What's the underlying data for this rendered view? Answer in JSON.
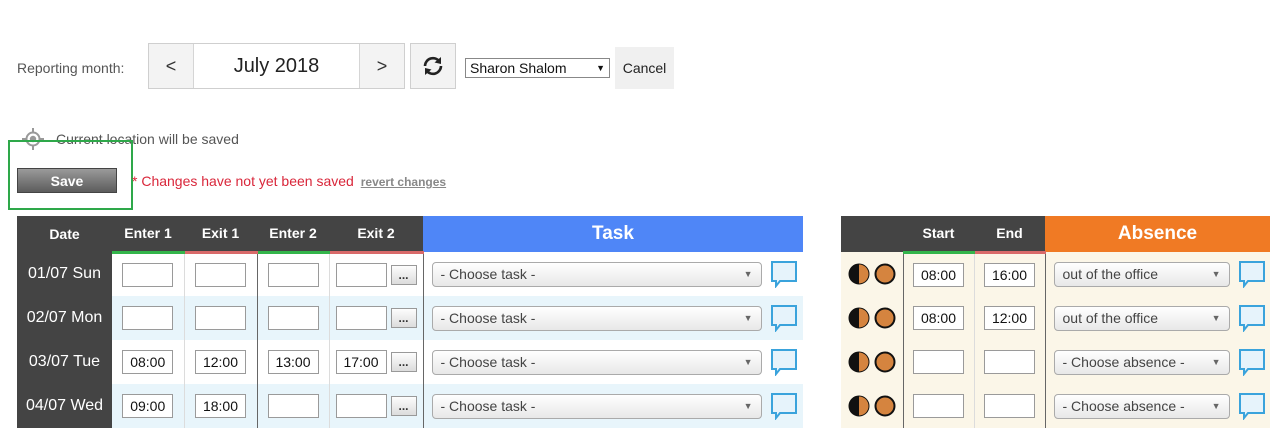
{
  "header": {
    "reporting_label": "Reporting month:",
    "prev_label": "<",
    "month": "July 2018",
    "next_label": ">",
    "refresh_icon": "refresh-icon",
    "user_selected": "Sharon Shalom",
    "cancel_label": "Cancel"
  },
  "location": {
    "icon": "location-crosshair-icon",
    "text": "Current location will be saved"
  },
  "save": {
    "label": "Save",
    "unsaved_text": "* Changes have not yet been saved",
    "revert_label": "revert changes"
  },
  "colors": {
    "task_header": "#4f86f7",
    "absence_header": "#f07a24",
    "enter_underline": "#33b54b",
    "exit_underline": "#d96a6a",
    "save_highlight": "#2ea84a",
    "warning_text": "#d9263a"
  },
  "time_table": {
    "headers": {
      "date": "Date",
      "enter1": "Enter 1",
      "exit1": "Exit 1",
      "enter2": "Enter 2",
      "exit2": "Exit 2",
      "task": "Task",
      "more_button": "..."
    },
    "rows": [
      {
        "date": "01/07 Sun",
        "enter1": "",
        "exit1": "",
        "enter2": "",
        "exit2": "",
        "task": "- Choose task -"
      },
      {
        "date": "02/07 Mon",
        "enter1": "",
        "exit1": "",
        "enter2": "",
        "exit2": "",
        "task": "- Choose task -"
      },
      {
        "date": "03/07 Tue",
        "enter1": "08:00",
        "exit1": "12:00",
        "enter2": "13:00",
        "exit2": "17:00",
        "task": "- Choose task -"
      },
      {
        "date": "04/07 Wed",
        "enter1": "09:00",
        "exit1": "18:00",
        "enter2": "",
        "exit2": "",
        "task": "- Choose task -"
      }
    ]
  },
  "absence_table": {
    "headers": {
      "start": "Start",
      "end": "End",
      "absence": "Absence"
    },
    "rows": [
      {
        "start": "08:00",
        "end": "16:00",
        "absence": "out of the office"
      },
      {
        "start": "08:00",
        "end": "12:00",
        "absence": "out of the office"
      },
      {
        "start": "",
        "end": "",
        "absence": "- Choose absence -"
      },
      {
        "start": "",
        "end": "",
        "absence": "- Choose absence -"
      }
    ]
  }
}
